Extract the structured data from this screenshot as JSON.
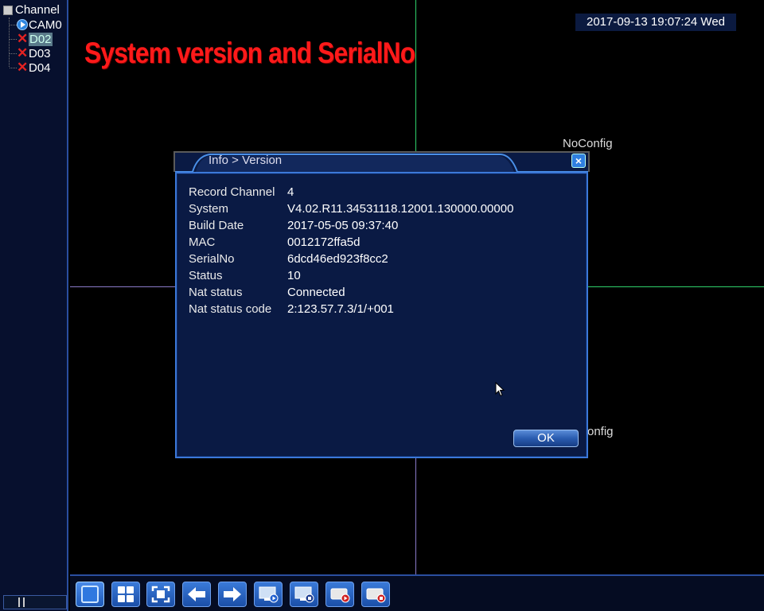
{
  "sidebar": {
    "title": "Channel",
    "channels": [
      {
        "label": "CAM0",
        "icon": "play-icon",
        "selected": false
      },
      {
        "label": "D02",
        "icon": "x-icon",
        "selected": true
      },
      {
        "label": "D03",
        "icon": "x-icon",
        "selected": false
      },
      {
        "label": "D04",
        "icon": "x-icon",
        "selected": false
      }
    ]
  },
  "overlay": {
    "caption": "System version and SerialNo"
  },
  "header": {
    "datetime": "2017-09-13 19:07:24 Wed"
  },
  "cells": {
    "noconfig_top": "NoConfig",
    "noconfig_bottom": "onfig"
  },
  "dialog": {
    "title": "Info > Version",
    "rows": [
      {
        "label": "Record Channel",
        "value": "4"
      },
      {
        "label": "System",
        "value": "V4.02.R11.34531118.12001.130000.00000"
      },
      {
        "label": "Build Date",
        "value": "2017-05-05 09:37:40"
      },
      {
        "label": "MAC",
        "value": "0012172ffa5d"
      },
      {
        "label": "SerialNo",
        "value": "6dcd46ed923f8cc2"
      },
      {
        "label": "Status",
        "value": "10"
      },
      {
        "label": "Nat status",
        "value": "Connected"
      },
      {
        "label": "Nat status code",
        "value": "2:123.57.7.3/1/+001"
      }
    ],
    "ok_label": "OK"
  },
  "toolbar": {
    "buttons": [
      "single-view-icon",
      "quad-view-icon",
      "fullscreen-icon",
      "prev-icon",
      "next-icon",
      "playback-icon",
      "record-icon",
      "record-play-icon",
      "record-stop-icon"
    ]
  },
  "colors": {
    "accent": "#3c78d8",
    "caption": "#ff1a1a",
    "grid_green": "#2fd06a",
    "grid_purple": "#8a7ac8"
  }
}
